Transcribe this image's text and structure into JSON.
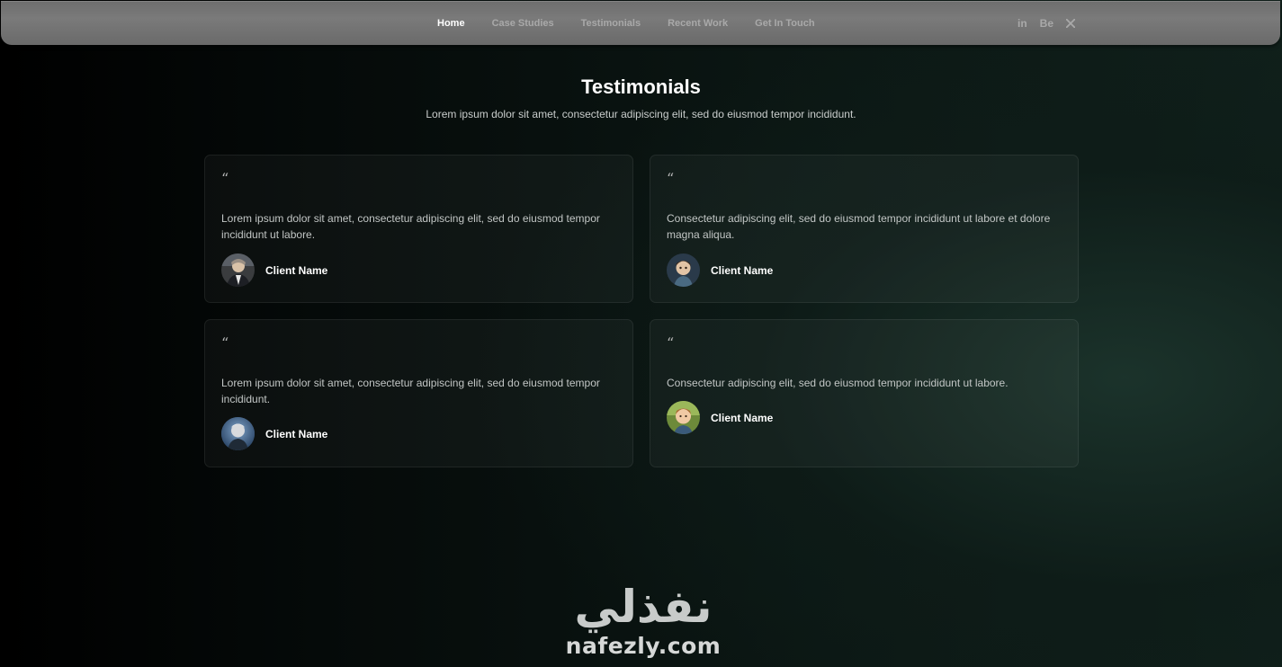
{
  "nav": {
    "links": [
      {
        "label": "Home",
        "active": true
      },
      {
        "label": "Case Studies",
        "active": false
      },
      {
        "label": "Testimonials",
        "active": false
      },
      {
        "label": "Recent Work",
        "active": false
      },
      {
        "label": "Get In Touch",
        "active": false
      }
    ],
    "socials": {
      "linkedin": "in",
      "behance": "Be",
      "x_icon": "x-twitter-icon"
    }
  },
  "section": {
    "title": "Testimonials",
    "subtitle": "Lorem ipsum dolor sit amet, consectetur adipiscing elit, sed do eiusmod tempor incididunt."
  },
  "testimonials": [
    {
      "quote_mark": "“",
      "text": "Lorem ipsum dolor sit amet, consectetur adipiscing elit, sed do eiusmod tempor incididunt ut labore.",
      "client_name": "Client Name"
    },
    {
      "quote_mark": "“",
      "text": "Consectetur adipiscing elit, sed do eiusmod tempor incididunt ut labore et dolore magna aliqua.",
      "client_name": "Client Name"
    },
    {
      "quote_mark": "“",
      "text": "Lorem ipsum dolor sit amet, consectetur adipiscing elit, sed do eiusmod tempor incididunt.",
      "client_name": "Client Name"
    },
    {
      "quote_mark": "“",
      "text": "Consectetur adipiscing elit, sed do eiusmod tempor incididunt ut labore.",
      "client_name": "Client Name"
    }
  ],
  "watermark": {
    "arabic": "نفذلي",
    "latin": "nafezly.com"
  },
  "colors": {
    "nav_bg": "#727272",
    "nav_active": "#ffffff",
    "nav_inactive": "#a9a9a9",
    "background_dark": "#000000",
    "background_accent": "#10201b"
  }
}
